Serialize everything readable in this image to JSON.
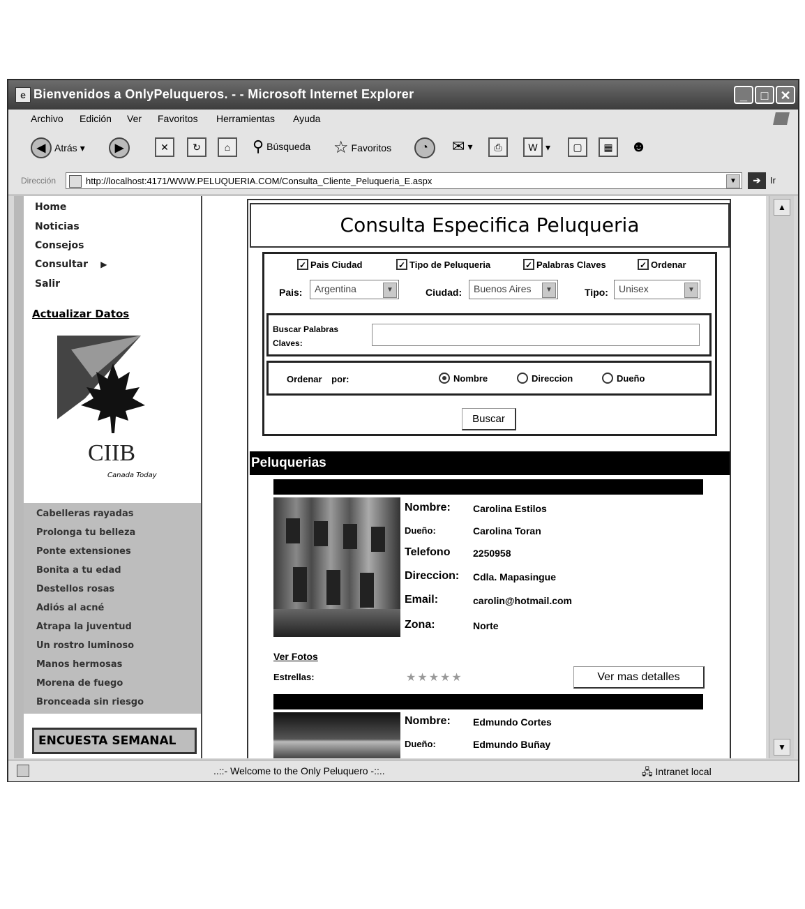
{
  "window": {
    "title": "Bienvenidos a OnlyPeluqueros. - - Microsoft Internet Explorer",
    "controls": [
      "minimize",
      "maximize",
      "close"
    ]
  },
  "menu": [
    "Archivo",
    "Edición",
    "Ver",
    "Favoritos",
    "Herramientas",
    "Ayuda"
  ],
  "toolbar": {
    "back_label": "Atrás",
    "search_label": "Búsqueda",
    "favorites_label": "Favoritos"
  },
  "address": {
    "label": "Dirección",
    "url": "http://localhost:4171/WWW.PELUQUERIA.COM/Consulta_Cliente_Peluqueria_E.aspx",
    "go_label": "Ir"
  },
  "nav": {
    "items": [
      "Home",
      "Noticias",
      "Consejos",
      "Consultar",
      "Salir"
    ],
    "update_link": "Actualizar Datos",
    "logo_text": "CIIB",
    "logo_sub": "Canada Today",
    "tips": [
      "Cabelleras rayadas",
      "Prolonga tu belleza",
      "Ponte extensiones",
      "Bonita a tu edad",
      "Destellos rosas",
      "Adiós al acné",
      "Atrapa la juventud",
      "Un rostro luminoso",
      "Manos hermosas",
      "Morena de fuego",
      "Bronceada sin riesgo"
    ],
    "survey": "ENCUESTA SEMANAL"
  },
  "page": {
    "title": "Consulta Especifica Peluqueria",
    "filters": {
      "checks": [
        {
          "label": "Pais Ciudad",
          "checked": true
        },
        {
          "label": "Tipo de Peluqueria",
          "checked": true
        },
        {
          "label": "Palabras Claves",
          "checked": true
        },
        {
          "label": "Ordenar",
          "checked": true
        }
      ],
      "pais_label": "Pais:",
      "pais_value": "Argentina",
      "ciudad_label": "Ciudad:",
      "ciudad_value": "Buenos Aires",
      "tipo_label": "Tipo:",
      "tipo_value": "Unisex",
      "keywords_label_1": "Buscar Palabras",
      "keywords_label_2": "Claves:",
      "keywords_value": "",
      "order_label": "Ordenar por:",
      "order_options": [
        {
          "label": "Nombre",
          "selected": true
        },
        {
          "label": "Direccion",
          "selected": false
        },
        {
          "label": "Dueño",
          "selected": false
        }
      ],
      "search_button": "Buscar"
    },
    "results_header": "Peluquerias",
    "results": [
      {
        "labels": [
          "Nombre:",
          "Dueño:",
          "Telefono",
          "Direccion:",
          "Email:",
          "Zona:"
        ],
        "nombre": "Carolina Estilos",
        "dueno": "Carolina Toran",
        "telefono": "2250958",
        "direccion": "Cdla. Mapasingue",
        "email": "carolin@hotmail.com",
        "zona": "Norte",
        "photos_link": "Ver Fotos",
        "stars_label": "Estrellas:",
        "stars": "★★★★★",
        "details_button": "Ver mas detalles"
      },
      {
        "labels": [
          "Nombre:",
          "Dueño:"
        ],
        "nombre": "Edmundo Cortes",
        "dueno": "Edmundo Buñay"
      }
    ]
  },
  "status": {
    "message": "..::- Welcome to the Only Peluquero -::..",
    "zone": "Intranet local"
  }
}
